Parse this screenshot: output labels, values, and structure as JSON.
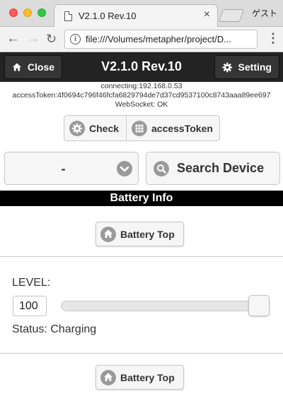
{
  "browser": {
    "tab_title": "V2.1.0 Rev.10",
    "tab_close": "×",
    "profile_label": "ゲスト",
    "url": "file:///Volumes/metapher/project/D..."
  },
  "header": {
    "close_label": "Close",
    "title": "V2.1.0 Rev.10",
    "setting_label": "Setting"
  },
  "status": {
    "connecting": "connecting:192.168.0.53",
    "access_token": "accessToken:4f0694c796f46fcfa6829794de7d37cd9537100c8743aaa89ee697",
    "websocket": "WebSocket: OK"
  },
  "controls": {
    "check_label": "Check",
    "access_token_label": "accessToken",
    "device_select_value": "-",
    "search_label": "Search Device"
  },
  "battery": {
    "section_title": "Battery Info",
    "top_button_label": "Battery Top",
    "level_label": "LEVEL:",
    "level_value": "100",
    "level_fraction": 1.0,
    "status_text": "Status: Charging",
    "bottom_button_label": "Battery Top"
  },
  "icons": {
    "home": "home-icon",
    "gear": "gear-icon",
    "grid": "grid-icon",
    "search": "search-icon",
    "chevron": "chevron-down-icon",
    "info": "info-icon"
  },
  "colors": {
    "header_bg": "#232323",
    "button_bg": "#f6f6f6",
    "icon_circle": "#9a9a9a",
    "infobar_bg": "#000000"
  }
}
